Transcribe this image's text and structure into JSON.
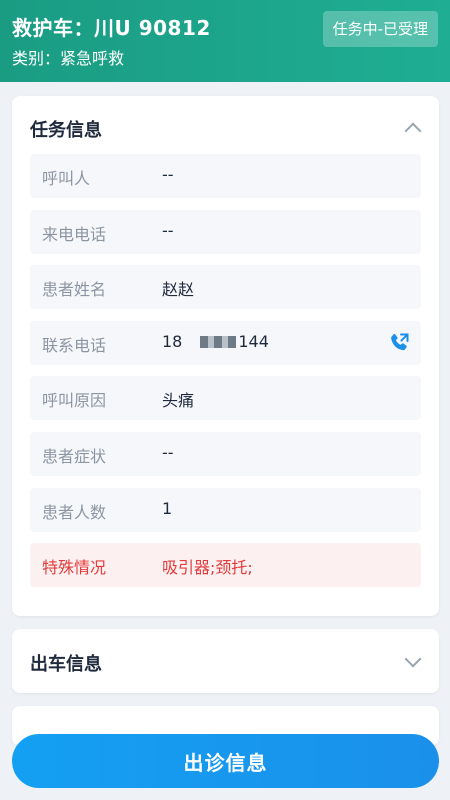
{
  "header": {
    "title": "救护车：川U 90812",
    "category": "类别：紧急呼救",
    "status": "任务中-已受理"
  },
  "task_card": {
    "title": "任务信息",
    "rows": [
      {
        "label": "呼叫人",
        "value": "--"
      },
      {
        "label": "来电电话",
        "value": "--"
      },
      {
        "label": "患者姓名",
        "value": "赵赵"
      },
      {
        "label": "联系电话",
        "value_prefix": "18",
        "value_suffix": "144"
      },
      {
        "label": "呼叫原因",
        "value": "头痛"
      },
      {
        "label": "患者症状",
        "value": "--"
      },
      {
        "label": "患者人数",
        "value": "1"
      },
      {
        "label": "特殊情况",
        "value": "吸引器;颈托;"
      }
    ]
  },
  "dispatch_card": {
    "title": "出车信息"
  },
  "bottom_button": {
    "label": "出诊信息"
  },
  "colors": {
    "header": "#1fae93",
    "primary": "#1a90ea",
    "alert": "#e23b3b"
  },
  "icons": {
    "collapse": "chevron-up-icon",
    "expand": "chevron-down-icon",
    "call": "phone-call-icon"
  }
}
